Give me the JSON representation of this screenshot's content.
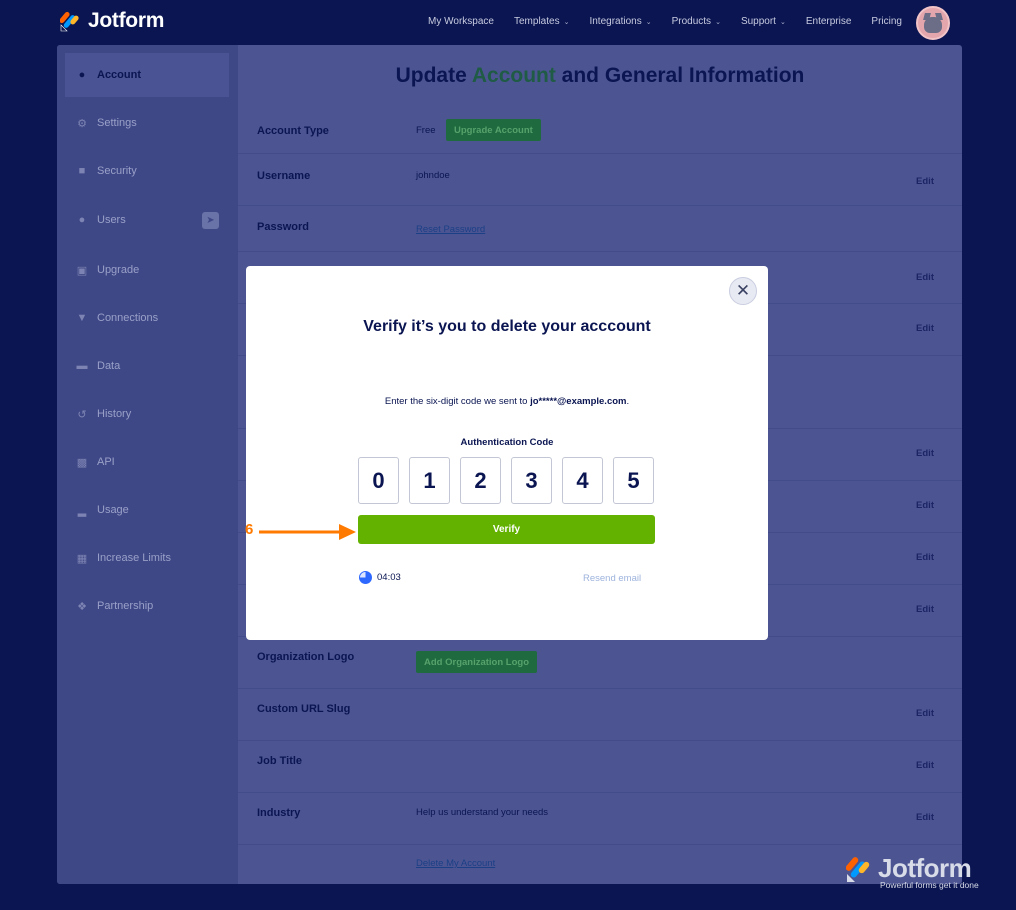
{
  "brand": {
    "name": "Jotform"
  },
  "nav": [
    {
      "label": "My Workspace",
      "dropdown": false
    },
    {
      "label": "Templates",
      "dropdown": true
    },
    {
      "label": "Integrations",
      "dropdown": true
    },
    {
      "label": "Products",
      "dropdown": true
    },
    {
      "label": "Support",
      "dropdown": true
    },
    {
      "label": "Enterprise",
      "dropdown": false
    },
    {
      "label": "Pricing",
      "dropdown": false
    }
  ],
  "sidebar": {
    "items": [
      {
        "label": "Account",
        "icon": "user-icon",
        "active": true
      },
      {
        "label": "Settings",
        "icon": "gear-icon"
      },
      {
        "label": "Security",
        "icon": "lock-icon"
      },
      {
        "label": "Users",
        "icon": "users-icon"
      },
      {
        "label": "Upgrade",
        "icon": "upgrade-icon"
      },
      {
        "label": "Connections",
        "icon": "plug-icon"
      },
      {
        "label": "Data",
        "icon": "database-icon"
      },
      {
        "label": "History",
        "icon": "history-icon"
      },
      {
        "label": "API",
        "icon": "api-icon"
      },
      {
        "label": "Usage",
        "icon": "bar-chart-icon"
      },
      {
        "label": "Increase Limits",
        "icon": "gift-icon"
      },
      {
        "label": "Partnership",
        "icon": "handshake-icon"
      }
    ]
  },
  "page": {
    "title_pre": "Update ",
    "title_accent": "Account",
    "title_post": " and General Information"
  },
  "rows": {
    "account_type": {
      "label": "Account Type",
      "value": "Free",
      "button": "Upgrade Account"
    },
    "username": {
      "label": "Username",
      "value": "johndoe",
      "edit": "Edit"
    },
    "password": {
      "label": "Password",
      "link": "Reset Password"
    },
    "edit_labels": [
      "Edit",
      "Edit",
      "Edit",
      "Edit",
      "Edit",
      "Edit"
    ],
    "org_logo": {
      "label": "Organization Logo",
      "button": "Add Organization Logo"
    },
    "url_slug": {
      "label": "Custom URL Slug",
      "edit": "Edit"
    },
    "job_title": {
      "label": "Job Title",
      "edit": "Edit"
    },
    "industry": {
      "label": "Industry",
      "value": "Help us understand your needs",
      "edit": "Edit"
    },
    "delete": {
      "link": "Delete My Account"
    }
  },
  "modal": {
    "title": "Verify it’s you to delete your acccount",
    "desc_prefix": "Enter the six-digit code we sent to ",
    "email": "jo*****@example.com",
    "desc_suffix": ".",
    "code_label": "Authentication Code",
    "digits": [
      "0",
      "1",
      "2",
      "3",
      "4",
      "5"
    ],
    "verify_label": "Verify",
    "timer": "04:03",
    "resend_label": "Resend email"
  },
  "annotation": {
    "step": "6",
    "color": "#ff7a00"
  },
  "watermark": {
    "name": "Jotform",
    "tagline": "Powerful forms get it done"
  },
  "colors": {
    "navy": "#0a1551",
    "green": "#64b200",
    "overlay": "#4c5592"
  }
}
